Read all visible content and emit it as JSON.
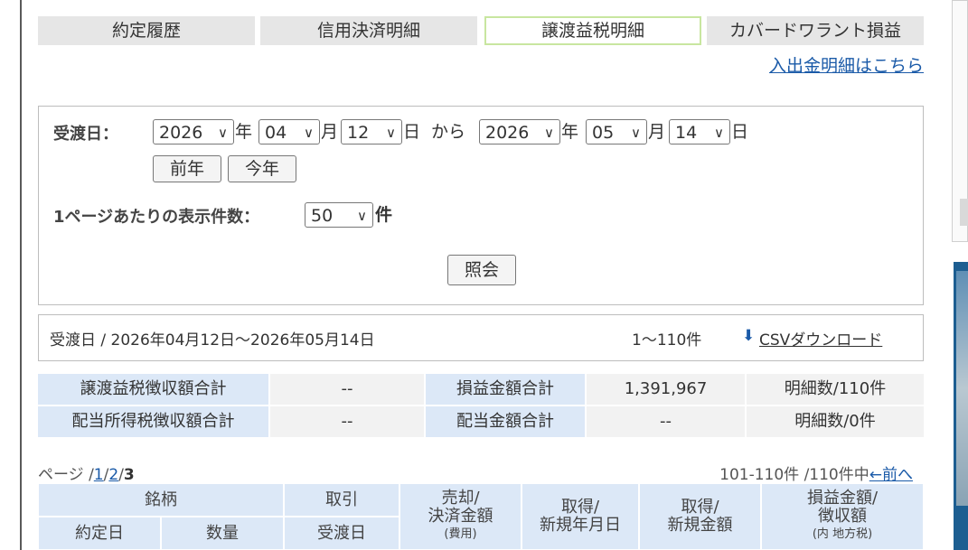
{
  "tabs": [
    {
      "label": "約定履歴",
      "active": false
    },
    {
      "label": "信用決済明細",
      "active": false
    },
    {
      "label": "譲渡益税明細",
      "active": true
    },
    {
      "label": "カバードワラント損益",
      "active": false
    }
  ],
  "deposit_link": "入出金明細はこちら",
  "search": {
    "date_label": "受渡日：",
    "from_year": "2026",
    "from_month": "04",
    "from_day": "12",
    "to_year": "2026",
    "to_month": "05",
    "to_day": "14",
    "year_unit": "年",
    "month_unit": "月",
    "day_unit": "日",
    "from_word": "から",
    "prev_year_button": "前年",
    "this_year_button": "今年",
    "per_page_label": "1ページあたりの表示件数：",
    "per_page_value": "50",
    "per_page_unit": "件",
    "submit_button": "照会"
  },
  "result_header": {
    "range_text": "受渡日 / 2026年04月12日〜2026年05月14日",
    "count_text": "1〜110件",
    "csv_icon": "download-icon",
    "csv_link": "CSVダウンロード"
  },
  "summary": {
    "rows": [
      [
        "譲渡益税徴収額合計",
        "--",
        "損益金額合計",
        "1,391,967",
        "明細数/110件"
      ],
      [
        "配当所得税徴収額合計",
        "--",
        "配当金額合計",
        "--",
        "明細数/0件"
      ]
    ]
  },
  "pager": {
    "prefix": "ページ /",
    "page1": "1",
    "page2": "2",
    "page3": "3",
    "sep": "/",
    "range_text": "101-110件 /110件中",
    "prev_link": "←前へ"
  },
  "detail_header": {
    "brand": "銘柄",
    "trade_date": "約定日",
    "quantity": "数量",
    "transaction": "取引",
    "settlement_date": "受渡日",
    "sale_line1": "売却/",
    "sale_line2": "決済金額",
    "sale_line3": "(費用)",
    "acq_date_line1": "取得/",
    "acq_date_line2": "新規年月日",
    "acq_amt_line1": "取得/",
    "acq_amt_line2": "新規金額",
    "pl_line1": "損益金額/",
    "pl_line2": "徴収額",
    "pl_line3": "(内 地方税)"
  },
  "colors": {
    "tab_bg": "#e6e6e6",
    "active_tab_border": "#c8e6a0",
    "header_blue": "#dce8f7",
    "link_blue": "#1a5aa8"
  }
}
